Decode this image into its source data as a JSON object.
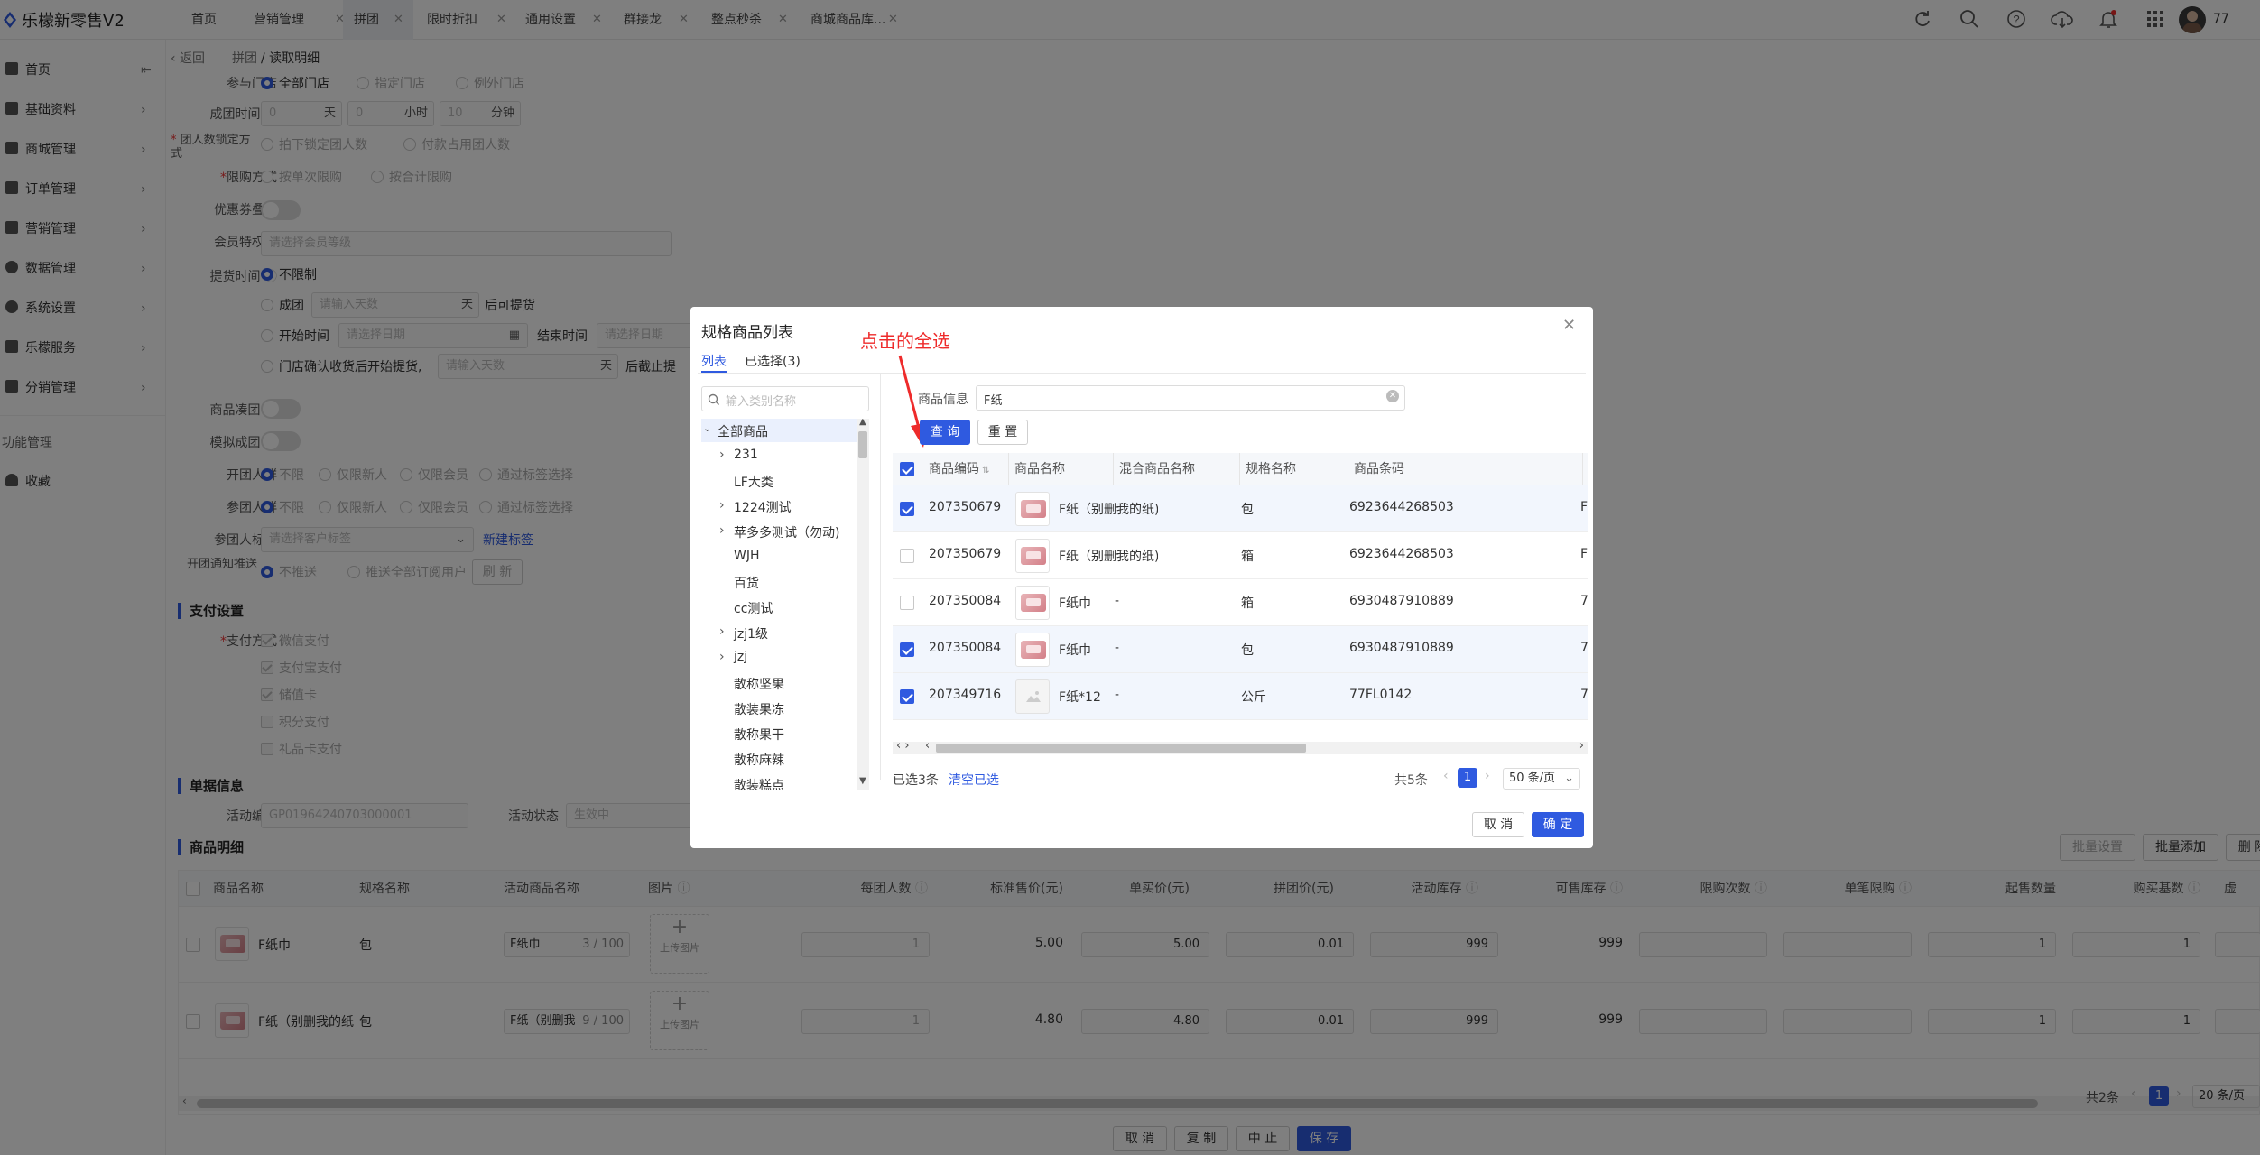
{
  "app": {
    "title": "乐檬新零售V2"
  },
  "tabs": [
    {
      "label": "首页"
    },
    {
      "label": "营销管理"
    },
    {
      "label": "拼团"
    },
    {
      "label": "限时折扣"
    },
    {
      "label": "通用设置"
    },
    {
      "label": "群接龙"
    },
    {
      "label": "整点秒杀"
    },
    {
      "label": "商城商品库..."
    }
  ],
  "header": {
    "user_count": "77"
  },
  "sidebar": {
    "items": [
      {
        "label": "首页"
      },
      {
        "label": "基础资料"
      },
      {
        "label": "商城管理"
      },
      {
        "label": "订单管理"
      },
      {
        "label": "营销管理"
      },
      {
        "label": "数据管理"
      },
      {
        "label": "系统设置"
      },
      {
        "label": "乐檬服务"
      },
      {
        "label": "分销管理"
      }
    ],
    "section": "功能管理",
    "fav": "收藏"
  },
  "breadcrumb": {
    "back": "返回",
    "parent": "拼团",
    "current": "读取明细"
  },
  "form": {
    "store_label": "参与门店",
    "store_opts": [
      "全部门店",
      "指定门店",
      "例外门店"
    ],
    "time_label": "成团时间",
    "time_day_val": "0",
    "time_day_unit": "天",
    "time_hour_val": "0",
    "time_hour_unit": "小时",
    "time_min_val": "10",
    "time_min_unit": "分钟",
    "lock_label": "团人数锁定方式",
    "lock_opts": [
      "拍下锁定团人数",
      "付款占用团人数"
    ],
    "limit_label": "限购方式",
    "limit_opts": [
      "按单次限购",
      "按合计限购"
    ],
    "coupon_label": "优惠券叠加",
    "member_label": "会员特权价",
    "member_placeholder": "请选择会员等级",
    "pickup_label": "提货时间",
    "pickup_opts": [
      "不限制",
      "成团",
      "开始时间",
      "门店确认收货后开始提货,"
    ],
    "pickup_days_placeholder": "请输入天数",
    "pickup_day_unit": "天",
    "pickup_after": "后可提货",
    "pickup_date_placeholder": "请选择日期",
    "pickup_end_label": "结束时间",
    "pickup_end_placeholder": "请选择日期",
    "pickup_store_placeholder": "请输入天数",
    "pickup_store_unit": "天",
    "pickup_store_after": "后截止提",
    "gather_label": "商品凑团",
    "sim_label": "模拟成团",
    "open_label": "开团人群",
    "join_label": "参团人群",
    "crowd_opts": [
      "不限",
      "仅限新人",
      "仅限会员",
      "通过标签选择"
    ],
    "tag_label": "参团人标签",
    "tag_placeholder": "请选择客户标签",
    "tag_new": "新建标签",
    "notify_label": "开团通知推送",
    "notify_opts": [
      "不推送",
      "推送全部订阅用户"
    ],
    "notify_btn": "刷 新",
    "pay_title": "支付设置",
    "pay_label": "支付方式",
    "pay_opts": [
      "微信支付",
      "支付宝支付",
      "储值卡",
      "积分支付",
      "礼品卡支付"
    ],
    "doc_title": "单据信息",
    "doc_no_label": "活动编号",
    "doc_no": "GP01964240703000001",
    "doc_status_label": "活动状态",
    "doc_status": "生效中",
    "detail_title": "商品明细",
    "batch_set": "批量设置",
    "batch_add": "批量添加",
    "batch_del": "删 除"
  },
  "grid": {
    "headers": [
      "商品名称",
      "规格名称",
      "活动商品名称",
      "图片",
      "每团人数",
      "标准售价(元)",
      "单买价(元)",
      "拼团价(元)",
      "活动库存",
      "可售库存",
      "限购次数",
      "单笔限购",
      "起售数量",
      "购买基数",
      "虚"
    ],
    "upload": "上传图片",
    "rows": [
      {
        "name": "F纸巾",
        "spec": "包",
        "act_name": "F纸巾",
        "count": "3 / 100",
        "per": "1",
        "std": "5.00",
        "single": "5.00",
        "group": "0.01",
        "stock": "999",
        "avail": "999",
        "min": "1",
        "base": "1"
      },
      {
        "name": "F纸（别删我的纸",
        "spec": "包",
        "act_name": "F纸（别删我",
        "count": "9 / 100",
        "per": "1",
        "std": "4.80",
        "single": "4.80",
        "group": "0.01",
        "stock": "999",
        "avail": "999",
        "min": "1",
        "base": "1"
      }
    ],
    "total": "共2条",
    "page": "1",
    "page_size": "20 条/页"
  },
  "footer": {
    "cancel": "取 消",
    "copy": "复 制",
    "stop": "中 止",
    "save": "保 存"
  },
  "modal": {
    "title": "规格商品列表",
    "tab_list": "列表",
    "tab_selected": "已选择(3)",
    "annotation": "点击的全选",
    "cat_placeholder": "输入类别名称",
    "tree": [
      {
        "label": "全部商品",
        "exp": "open"
      },
      {
        "label": "231",
        "exp": "closed"
      },
      {
        "label": "LF大类",
        "exp": ""
      },
      {
        "label": "1224测试",
        "exp": "closed"
      },
      {
        "label": "苹多多测试（勿动)",
        "exp": "closed"
      },
      {
        "label": "WJH",
        "exp": ""
      },
      {
        "label": "百货",
        "exp": ""
      },
      {
        "label": "cc测试",
        "exp": ""
      },
      {
        "label": "jzj1级",
        "exp": "closed"
      },
      {
        "label": "jzj",
        "exp": "closed"
      },
      {
        "label": "散称坚果",
        "exp": ""
      },
      {
        "label": "散装果冻",
        "exp": ""
      },
      {
        "label": "散称果干",
        "exp": ""
      },
      {
        "label": "散称麻辣",
        "exp": ""
      },
      {
        "label": "散装糕点",
        "exp": ""
      }
    ],
    "search_label": "商品信息",
    "search_value": "F纸",
    "query": "查 询",
    "reset": "重 置",
    "headers": [
      "商品编码",
      "商品名称",
      "混合商品名称",
      "规格名称",
      "商品条码"
    ],
    "rows": [
      {
        "checked": true,
        "code": "207350679",
        "name": "F纸（别删我的纸)",
        "mix": "-",
        "spec": "包",
        "bar": "6923644268503",
        "extra": "F"
      },
      {
        "checked": false,
        "code": "207350679",
        "name": "F纸（别删我的纸)",
        "mix": "-",
        "spec": "箱",
        "bar": "6923644268503",
        "extra": "F"
      },
      {
        "checked": false,
        "code": "207350084",
        "name": "F纸巾",
        "mix": "-",
        "spec": "箱",
        "bar": "6930487910889",
        "extra": "7"
      },
      {
        "checked": true,
        "code": "207350084",
        "name": "F纸巾",
        "mix": "-",
        "spec": "包",
        "bar": "6930487910889",
        "extra": "7"
      },
      {
        "checked": true,
        "code": "207349716",
        "name": "F纸*12",
        "mix": "-",
        "spec": "公斤",
        "bar": "77FL0142",
        "extra": "7"
      }
    ],
    "selected_count": "已选3条",
    "clear": "清空已选",
    "total": "共5条",
    "page": "1",
    "page_size": "50 条/页",
    "cancel": "取 消",
    "ok": "确 定"
  },
  "colors": {
    "primary": "#2f5ae0",
    "annotation": "#ee2b2b"
  }
}
